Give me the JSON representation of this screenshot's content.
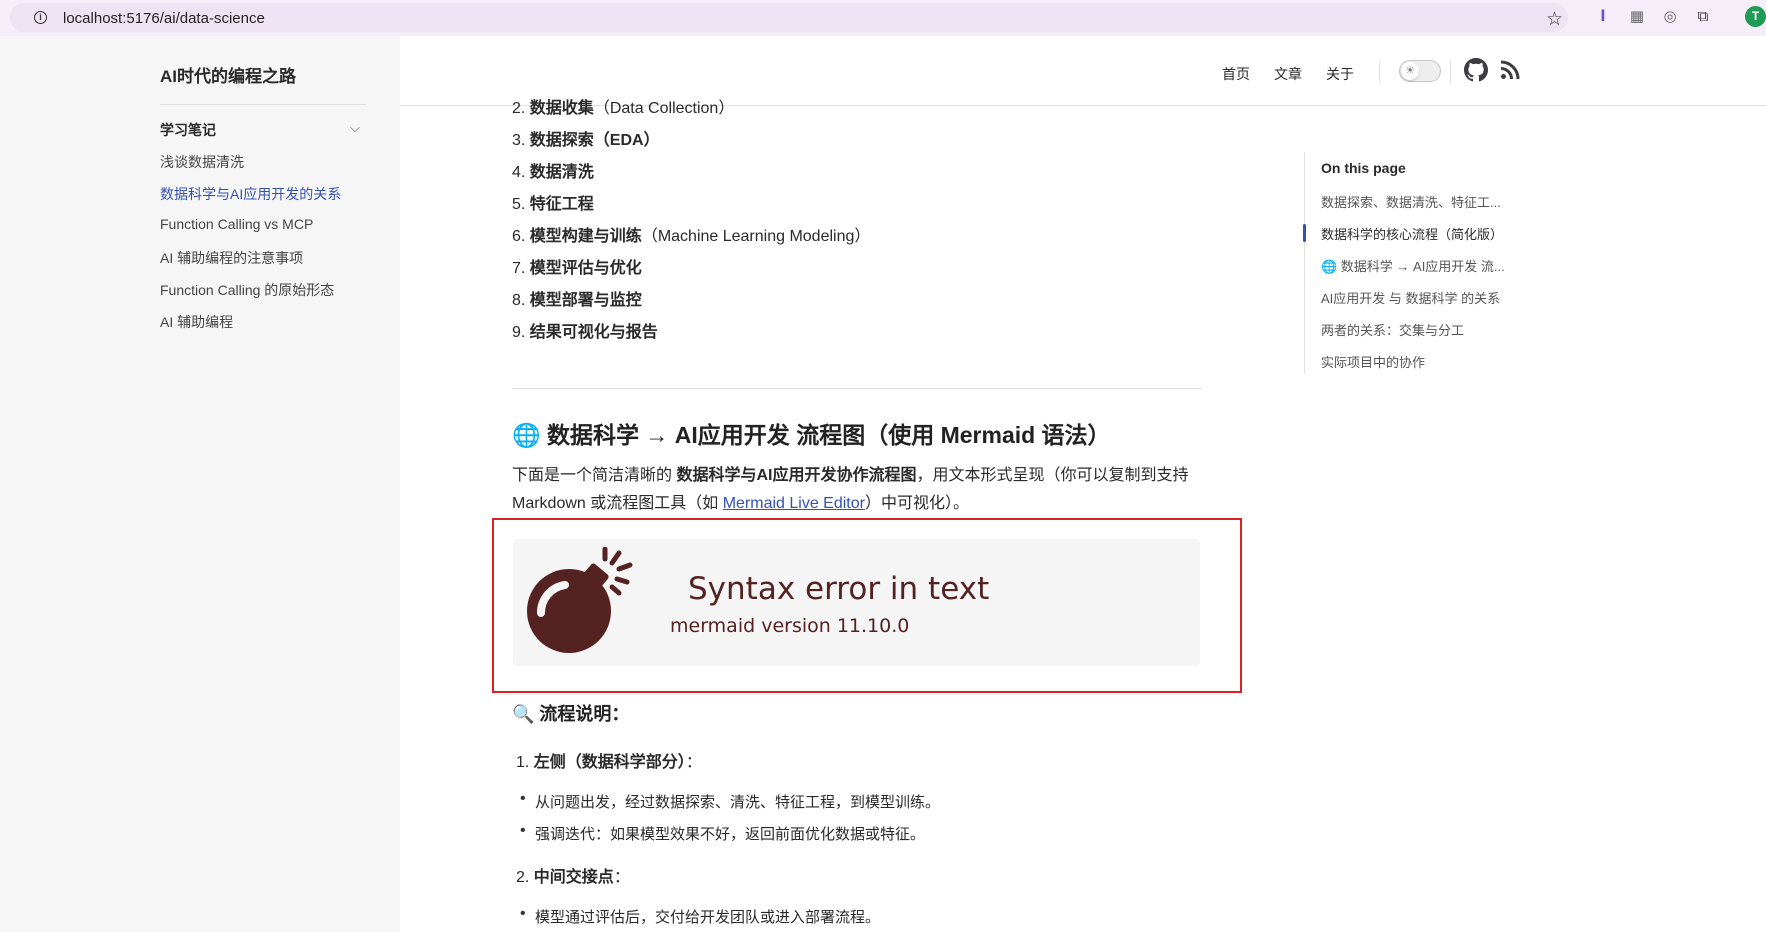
{
  "browser": {
    "url": "localhost:5176/ai/data-science",
    "avatar_letter": "T"
  },
  "sidebar": {
    "site_title": "AI时代的编程之路",
    "section_title": "学习笔记",
    "items": [
      {
        "label": "浅谈数据清洗"
      },
      {
        "label": "数据科学与AI应用开发的关系",
        "active": true
      },
      {
        "label": "Function Calling vs MCP"
      },
      {
        "label": "AI 辅助编程的注意事项"
      },
      {
        "label": "Function Calling 的原始形态"
      },
      {
        "label": "AI 辅助编程"
      }
    ]
  },
  "topnav": {
    "links": [
      "首页",
      "文章",
      "关于"
    ]
  },
  "content": {
    "steps": [
      {
        "num": "2.",
        "bold": "数据收集",
        "rest": "（Data Collection）"
      },
      {
        "num": "3.",
        "bold": "数据探索（EDA）",
        "rest": ""
      },
      {
        "num": "4.",
        "bold": "数据清洗",
        "rest": ""
      },
      {
        "num": "5.",
        "bold": "特征工程",
        "rest": ""
      },
      {
        "num": "6.",
        "bold": "模型构建与训练",
        "rest": "（Machine Learning Modeling）"
      },
      {
        "num": "7.",
        "bold": "模型评估与优化",
        "rest": ""
      },
      {
        "num": "8.",
        "bold": "模型部署与监控",
        "rest": ""
      },
      {
        "num": "9.",
        "bold": "结果可视化与报告",
        "rest": ""
      }
    ],
    "heading": "🌐 数据科学 → AI应用开发 流程图（使用 Mermaid 语法）",
    "intro_1": "下面是一个简洁清晰的 ",
    "intro_bold": "数据科学与AI应用开发协作流程图",
    "intro_2": "，用文本形式呈现（你可以复制到支持 Markdown 或流程图工具（如 ",
    "intro_link": "Mermaid Live Editor",
    "intro_3": "）中可视化）。",
    "error_title": "Syntax error in text",
    "error_version": "mermaid version 11.10.0",
    "flow_heading": "🔍 流程说明：",
    "left_num": "1.",
    "left_label": "左侧（数据科学部分）",
    "left_suffix": "：",
    "left_bullets": [
      "从问题出发，经过数据探索、清洗、特征工程，到模型训练。",
      "强调迭代：如果模型效果不好，返回前面优化数据或特征。"
    ],
    "mid_num": "2.",
    "mid_label": "中间交接点",
    "mid_suffix": "：",
    "mid_bullets": [
      "模型通过评估后，交付给开发团队或进入部署流程。"
    ]
  },
  "toc": {
    "title": "On this page",
    "items": [
      {
        "label": "数据探索、数据清洗、特征工..."
      },
      {
        "label": "数据科学的核心流程（简化版）",
        "active": true
      },
      {
        "label": "🌐 数据科学 → AI应用开发 流..."
      },
      {
        "label": "AI应用开发 与 数据科学 的关系"
      },
      {
        "label": "两者的关系：交集与分工"
      },
      {
        "label": "实际项目中的协作"
      }
    ]
  },
  "colors": {
    "accent": "#3451b2",
    "error_text": "#552222",
    "highlight_border": "#dd1f26"
  }
}
